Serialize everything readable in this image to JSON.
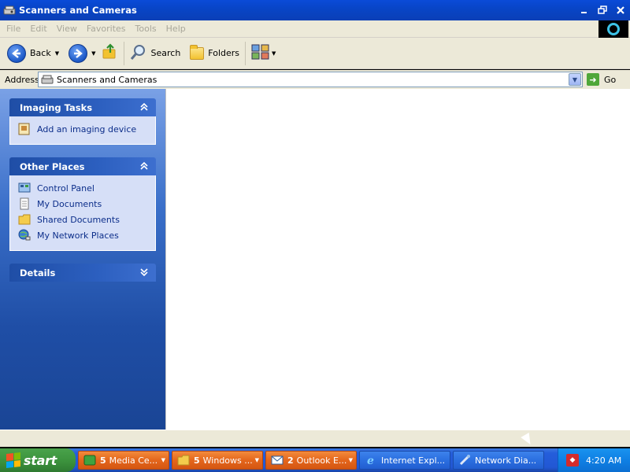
{
  "window": {
    "title": "Scanners and Cameras",
    "icon": "scanner-camera-icon",
    "controls": [
      "minimize",
      "maximize",
      "close"
    ]
  },
  "menu": [
    "File",
    "Edit",
    "View",
    "Favorites",
    "Tools",
    "Help"
  ],
  "toolbar": {
    "back_label": "Back",
    "search_label": "Search",
    "folders_label": "Folders",
    "views_icon": "views-icon"
  },
  "address": {
    "label": "Address",
    "value": "Scanners and Cameras",
    "go_label": "Go"
  },
  "sidebar": {
    "imaging": {
      "title": "Imaging Tasks",
      "items": [
        {
          "label": "Add an imaging device",
          "icon": "add-device-icon"
        }
      ]
    },
    "other": {
      "title": "Other Places",
      "items": [
        {
          "label": "Control Panel",
          "icon": "control-panel-icon"
        },
        {
          "label": "My Documents",
          "icon": "my-documents-icon"
        },
        {
          "label": "Shared Documents",
          "icon": "shared-documents-icon"
        },
        {
          "label": "My Network Places",
          "icon": "network-places-icon"
        }
      ]
    },
    "details": {
      "title": "Details"
    }
  },
  "taskbar": {
    "start_label": "start",
    "buttons": [
      {
        "count": "5",
        "label": "Media Ce...",
        "style": "orange",
        "icon": "media-center-icon"
      },
      {
        "count": "5",
        "label": "Windows ...",
        "style": "orange",
        "icon": "windows-explorer-icon"
      },
      {
        "count": "2",
        "label": "Outlook E...",
        "style": "orange",
        "icon": "outlook-express-icon"
      },
      {
        "count": "",
        "label": "Internet Expl...",
        "style": "blue",
        "icon": "internet-explorer-icon"
      },
      {
        "count": "",
        "label": "Network Dia...",
        "style": "blue",
        "icon": "network-diagnostics-icon"
      }
    ],
    "clock": "4:20 AM"
  },
  "colors": {
    "title_bar": "#0845c7",
    "sidebar_top": "#7aa1e6",
    "sidebar_bottom": "#1a4595",
    "taskbar": "#245edb",
    "start_green": "#3d943e",
    "task_orange": "#e4661c",
    "tray_blue": "#0f80e4"
  }
}
